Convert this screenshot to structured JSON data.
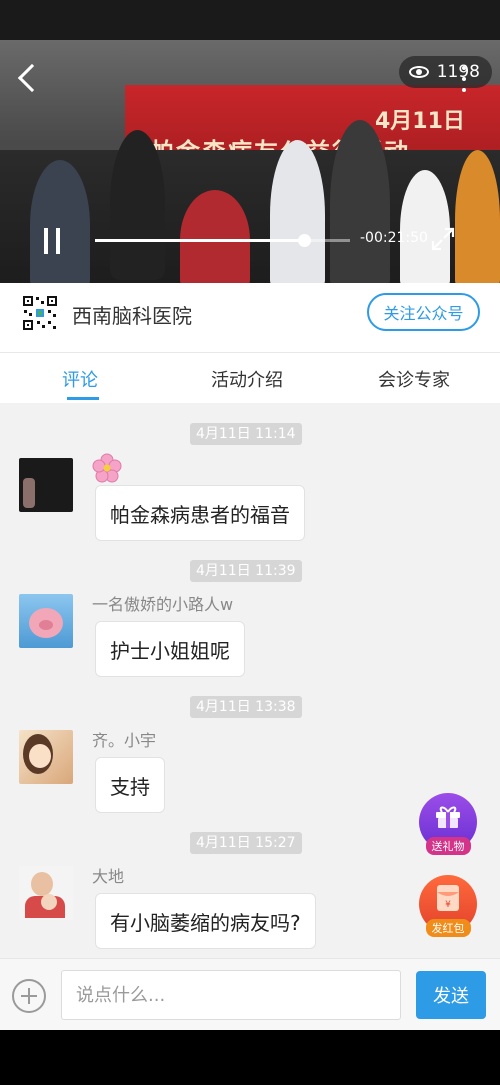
{
  "video": {
    "view_count": "1198",
    "banner_title": "帕金森病友公益行活动",
    "banner_date": "4月11日",
    "time_remaining": "-00:21:50",
    "progress_fraction": 0.82
  },
  "account": {
    "name": "西南脑科医院",
    "follow_label": "关注公众号"
  },
  "tabs": [
    {
      "label": "评论",
      "active": true
    },
    {
      "label": "活动介绍",
      "active": false
    },
    {
      "label": "会诊专家",
      "active": false
    }
  ],
  "messages": [
    {
      "time": "4月11日 11:14",
      "nickname": "",
      "text": "帕金森病患者的福音"
    },
    {
      "time": "4月11日 11:39",
      "nickname": "一名傲娇的小路人w",
      "text": "护士小姐姐呢"
    },
    {
      "time": "4月11日 13:38",
      "nickname": "齐。小宇",
      "text": "支持"
    },
    {
      "time": "4月11日 15:27",
      "nickname": "大地",
      "text": "有小脑萎缩的病友吗?"
    }
  ],
  "fabs": {
    "gift_label": "送礼物",
    "red_packet_label": "发红包"
  },
  "input": {
    "placeholder": "说点什么...",
    "send_label": "发送"
  },
  "colors": {
    "accent": "#2e9be6",
    "chat_bg": "#f2f2f2",
    "banner_red": "#c8262a"
  }
}
